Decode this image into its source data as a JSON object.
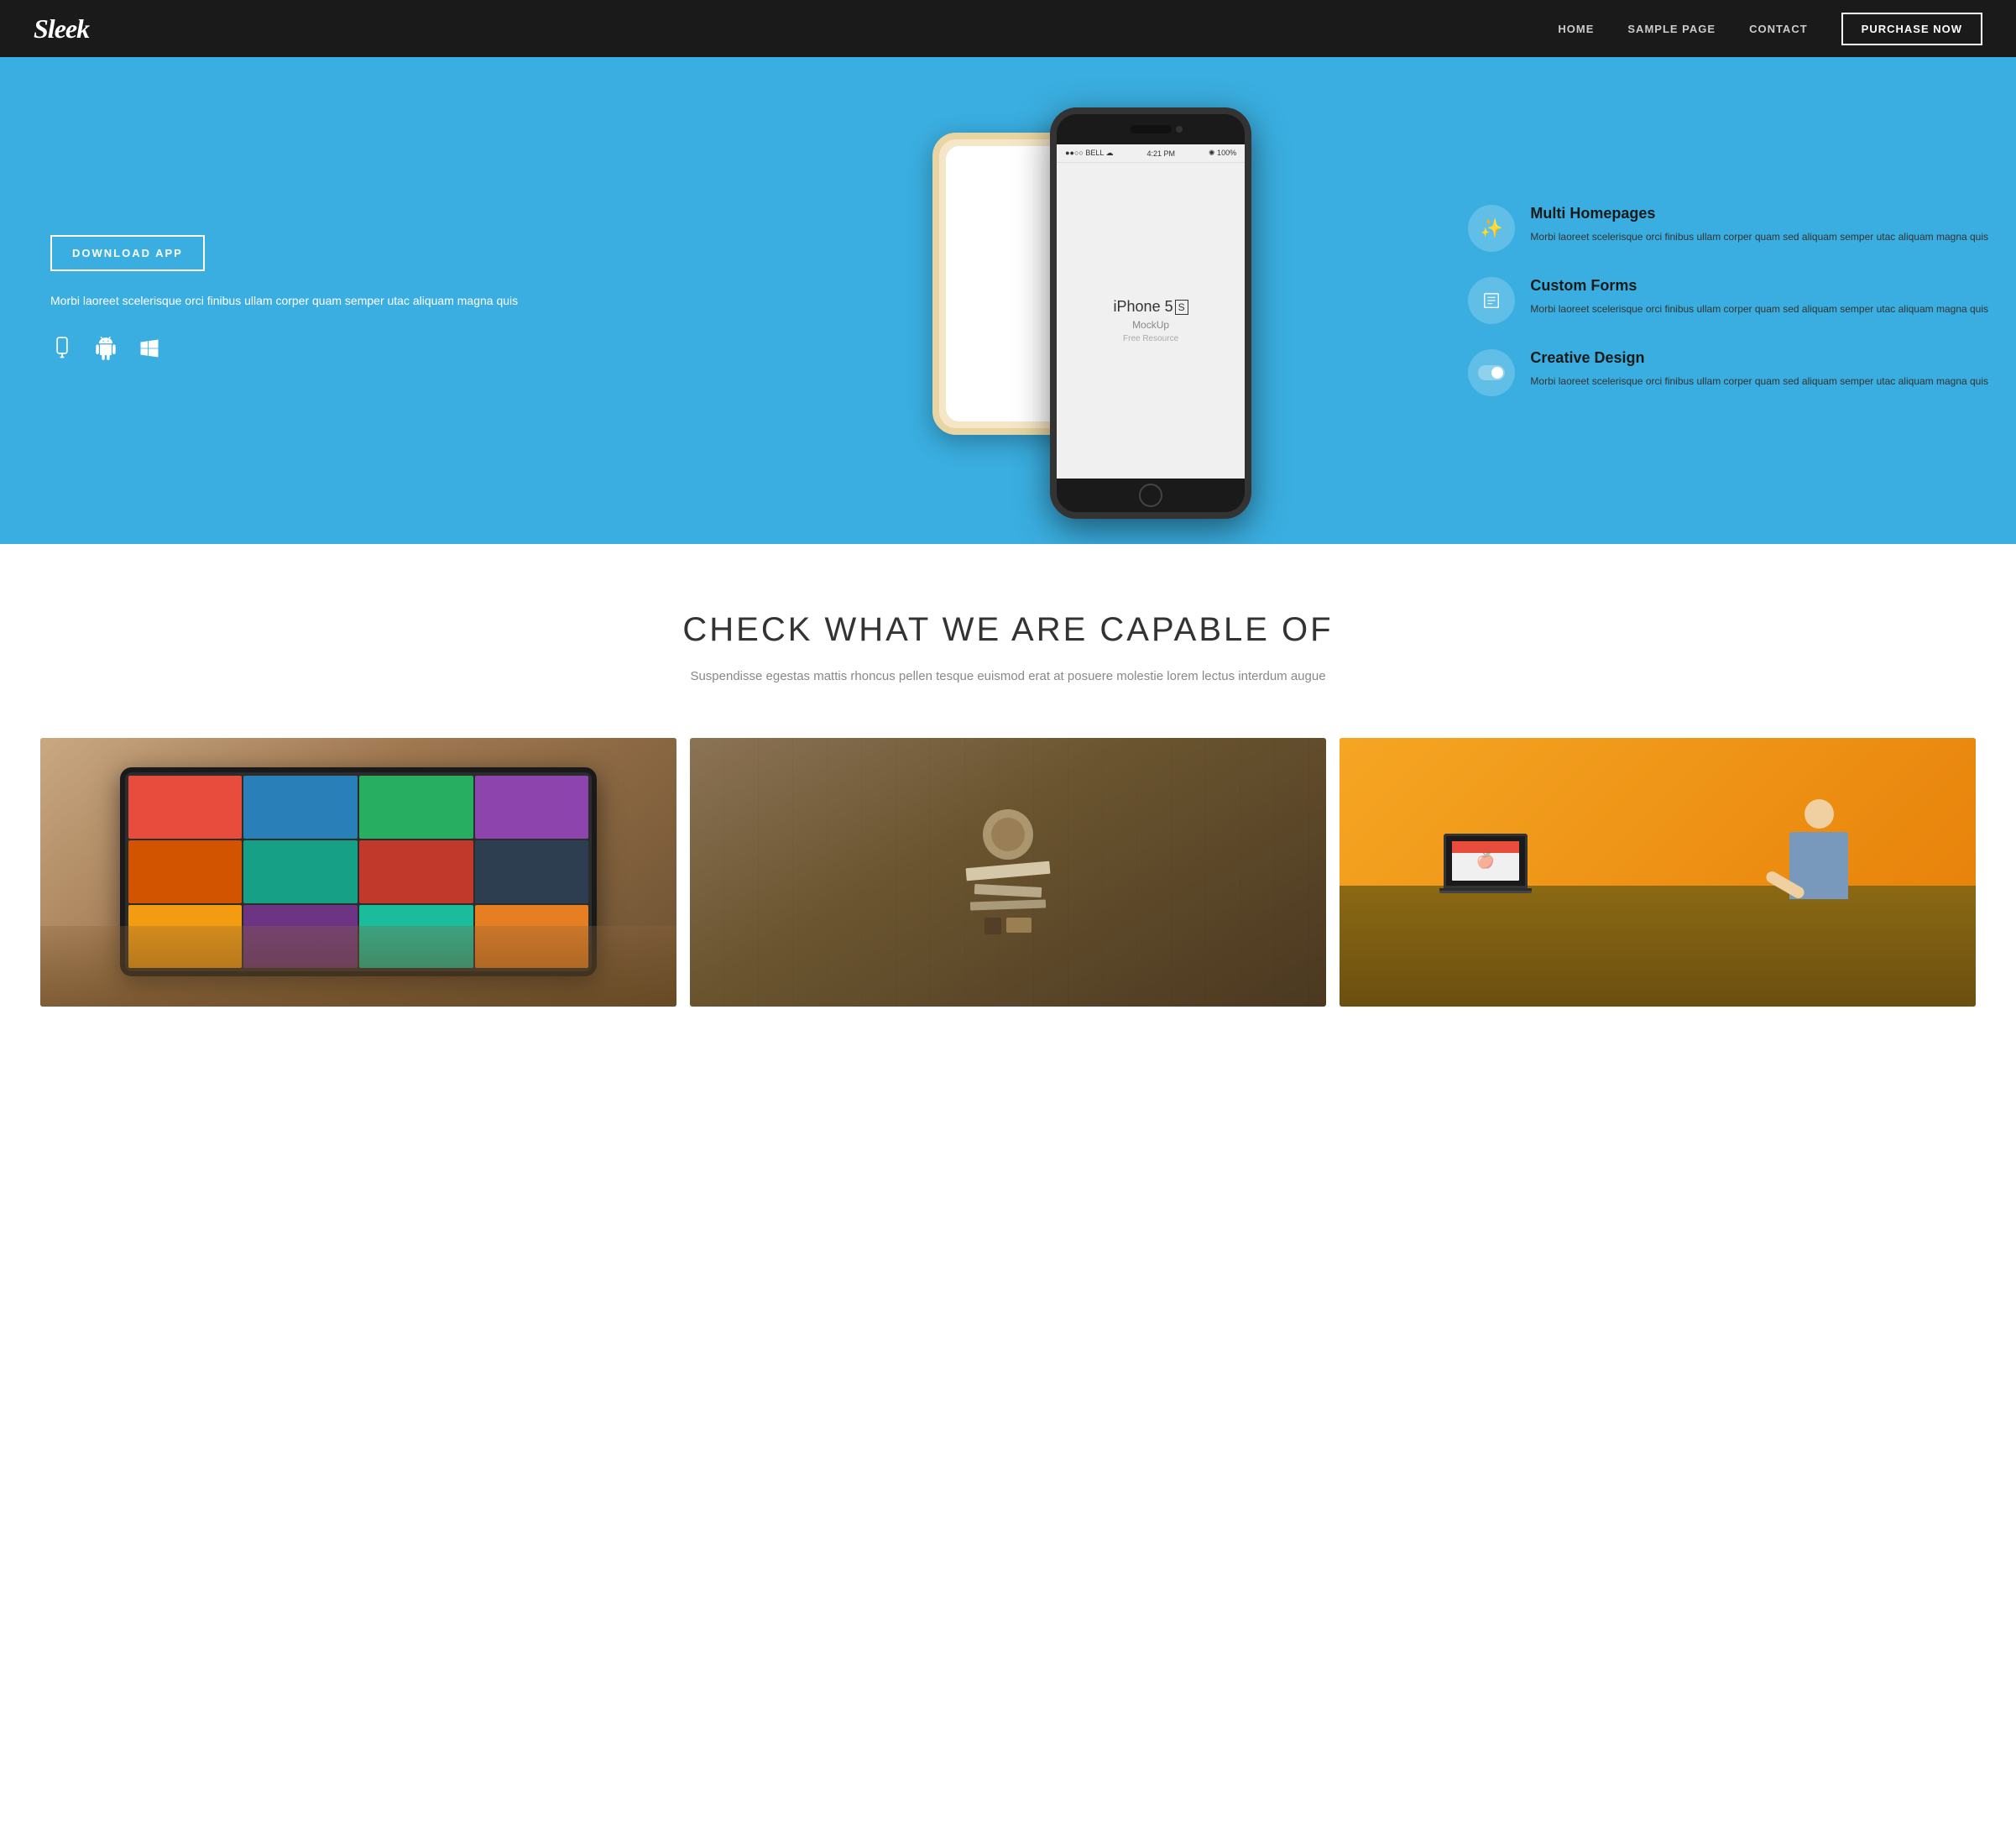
{
  "brand": {
    "logo": "Sleek"
  },
  "nav": {
    "links": [
      {
        "label": "HOME",
        "href": "#"
      },
      {
        "label": "SAMPLE PAGE",
        "href": "#"
      },
      {
        "label": "CONTACT",
        "href": "#"
      }
    ],
    "cta_label": "PURCHASE NOW"
  },
  "hero": {
    "download_btn": "DOWNLOAD APP",
    "description": "Morbi laoreet scelerisque orci finibus ullam corper quam semper utac aliquam magna quis",
    "platforms": [
      "📱",
      "🤖",
      "⊞"
    ],
    "features": [
      {
        "icon": "✨",
        "title": "Multi Homepages",
        "desc": "Morbi laoreet scelerisque orci finibus ullam corper quam sed aliquam semper utac aliquam magna quis"
      },
      {
        "icon": "▣",
        "title": "Custom Forms",
        "desc": "Morbi laoreet scelerisque orci finibus ullam corper quam sed aliquam semper utac aliquam magna quis"
      },
      {
        "icon": "⬤",
        "title": "Creative Design",
        "desc": "Morbi laoreet scelerisque orci finibus ullam corper quam sed aliquam semper utac aliquam magna quis"
      }
    ],
    "phone_label": "iPhone 5",
    "phone_sublabel": "MockUp",
    "phone_sublabel2": "Free Resource",
    "status_bar_left": "●●○○ BELL ☁",
    "status_bar_time": "4:21 PM",
    "status_bar_right": "✺ 100%"
  },
  "capable": {
    "title": "CHECK WHAT WE ARE CAPABLE OF",
    "subtitle": "Suspendisse egestas mattis rhoncus pellen tesque euismod erat at posuere molestie lorem lectus interdum augue"
  },
  "gallery": {
    "cards": [
      {
        "type": "tablet",
        "alt": "Tablet with app thumbnails"
      },
      {
        "type": "items",
        "alt": "Stationery and items on wooden surface"
      },
      {
        "type": "person",
        "alt": "Person working on laptop"
      }
    ]
  }
}
